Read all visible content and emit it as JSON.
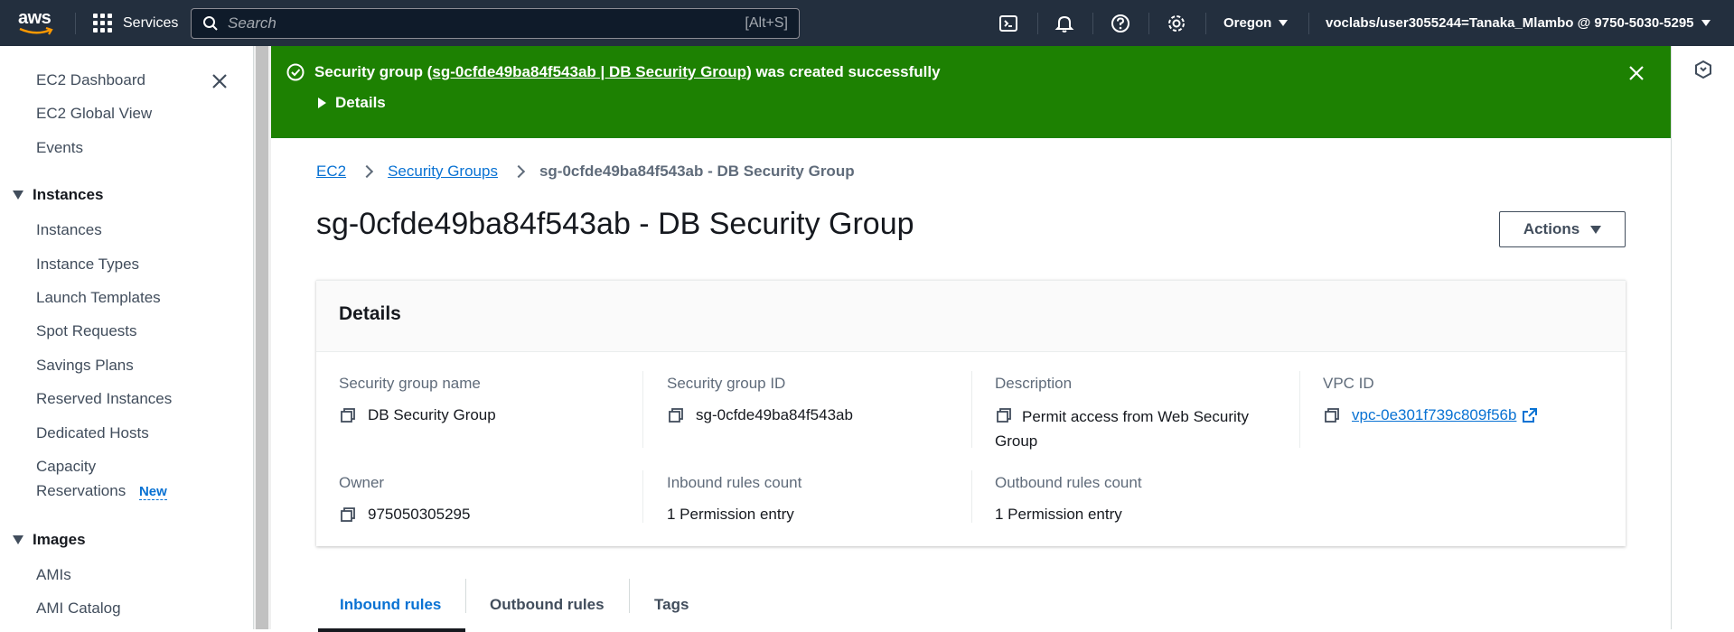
{
  "topnav": {
    "logo_text": "aws",
    "services_label": "Services",
    "search_placeholder": "Search",
    "search_shortcut": "[Alt+S]",
    "region": "Oregon",
    "account": "voclabs/user3055244=Tanaka_Mlambo @ 9750-5030-5295"
  },
  "sidebar": {
    "items_top": [
      "EC2 Dashboard",
      "EC2 Global View",
      "Events"
    ],
    "section_instances": "Instances",
    "instances_items": [
      "Instances",
      "Instance Types",
      "Launch Templates",
      "Spot Requests",
      "Savings Plans",
      "Reserved Instances",
      "Dedicated Hosts"
    ],
    "capacity_line1": "Capacity",
    "capacity_line2": "Reservations",
    "new_badge": "New",
    "section_images": "Images",
    "images_items": [
      "AMIs",
      "AMI Catalog"
    ]
  },
  "flash": {
    "prefix": "Security group (",
    "link": "sg-0cfde49ba84f543ab | DB Security Group",
    "suffix": ") was created successfully",
    "details_label": "Details",
    "color": "#1d8102"
  },
  "breadcrumb": {
    "items": [
      "EC2",
      "Security Groups"
    ],
    "current": "sg-0cfde49ba84f543ab - DB Security Group"
  },
  "page": {
    "title": "sg-0cfde49ba84f543ab - DB Security Group",
    "actions_label": "Actions"
  },
  "details": {
    "heading": "Details",
    "sg_name_label": "Security group name",
    "sg_name": "DB Security Group",
    "sg_id_label": "Security group ID",
    "sg_id": "sg-0cfde49ba84f543ab",
    "description_label": "Description",
    "description_line1": "Permit access from Web Security",
    "description_line2": "Group",
    "vpc_label": "VPC ID",
    "vpc_id": "vpc-0e301f739c809f56b",
    "owner_label": "Owner",
    "owner": "975050305295",
    "inbound_label": "Inbound rules count",
    "inbound": "1 Permission entry",
    "outbound_label": "Outbound rules count",
    "outbound": "1 Permission entry"
  },
  "tabs": [
    "Inbound rules",
    "Outbound rules",
    "Tags"
  ],
  "icons": {
    "search": "search-icon",
    "cloudshell": "cloudshell-icon",
    "notifications": "bell-icon",
    "help": "help-icon",
    "settings": "gear-icon",
    "copy": "copy-icon",
    "external": "external-link-icon",
    "close": "close-icon",
    "success": "check-circle-icon"
  },
  "colors": {
    "nav_bg": "#232f3e",
    "link": "#0972d3",
    "success": "#1d8102"
  }
}
